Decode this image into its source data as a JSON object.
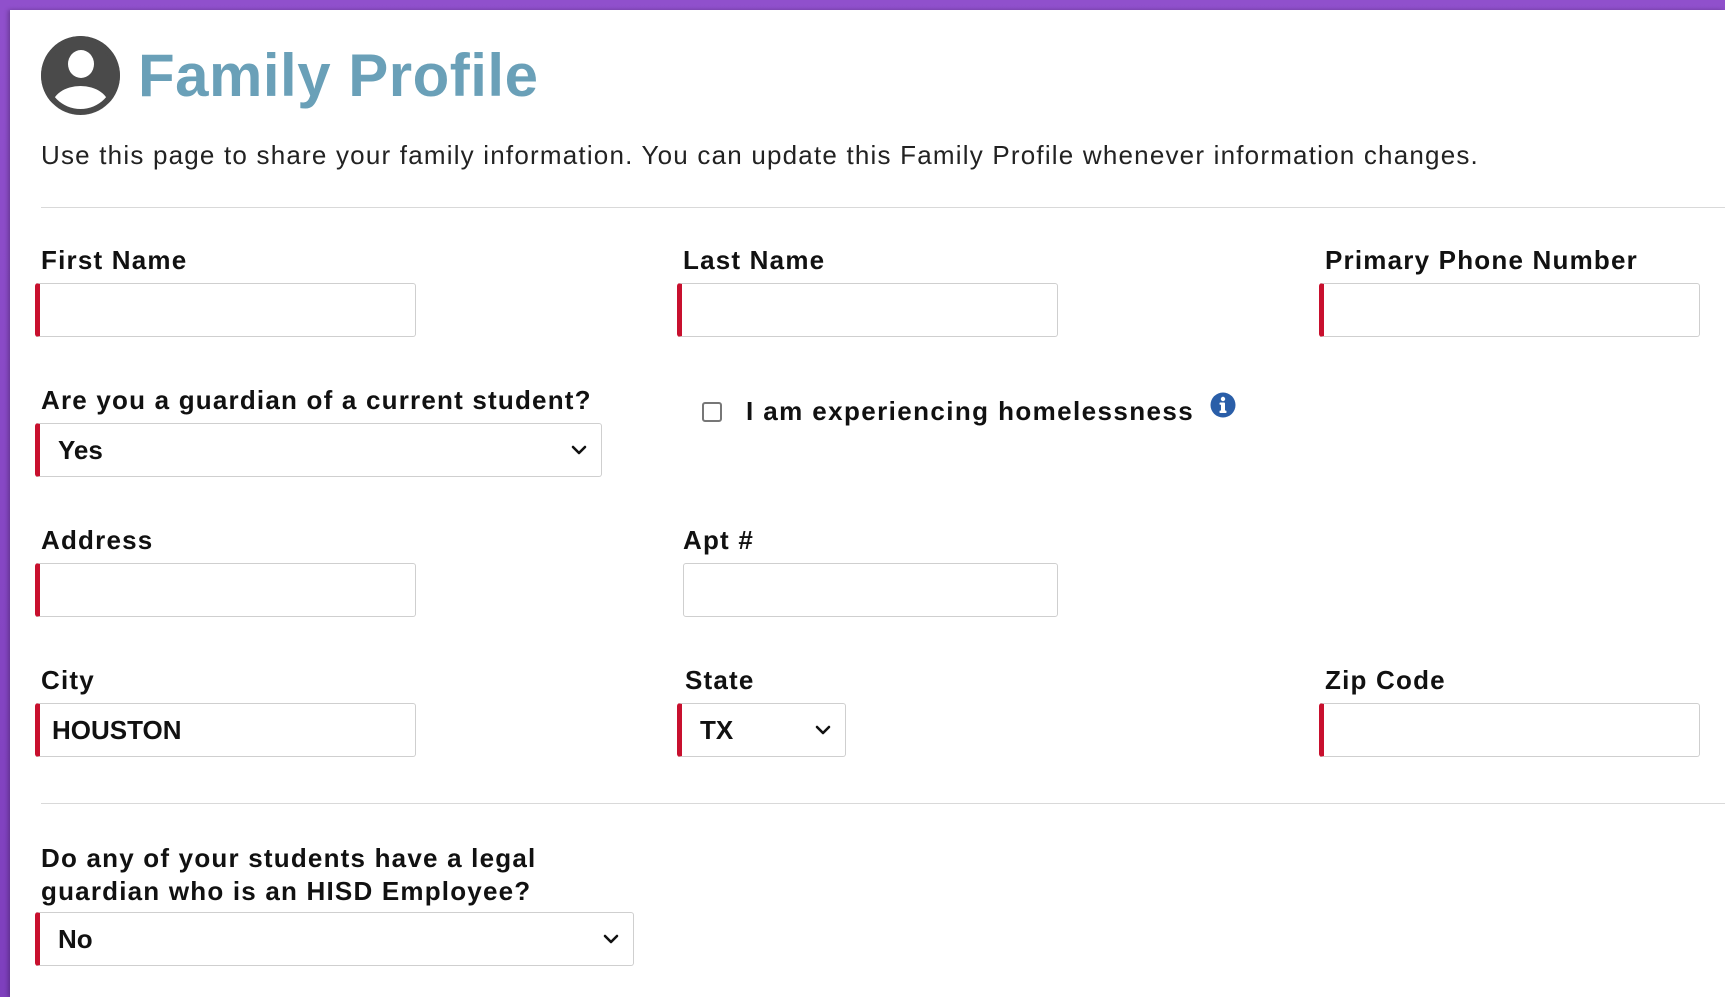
{
  "page": {
    "title": "Family Profile",
    "intro": "Use this page to share your family information. You can update this Family Profile whenever information changes."
  },
  "form": {
    "first_name": {
      "label": "First Name",
      "value": ""
    },
    "last_name": {
      "label": "Last Name",
      "value": ""
    },
    "phone": {
      "label": "Primary Phone Number",
      "value": ""
    },
    "guardian": {
      "label": "Are you a guardian of a current student?",
      "selected": "Yes"
    },
    "homeless": {
      "label": "I am experiencing homelessness",
      "checked": false
    },
    "address": {
      "label": "Address",
      "value": ""
    },
    "apt": {
      "label": "Apt #",
      "value": ""
    },
    "city": {
      "label": "City",
      "value": "HOUSTON"
    },
    "state": {
      "label": "State",
      "selected": "TX"
    },
    "zip": {
      "label": "Zip Code",
      "value": ""
    },
    "hisd_employee": {
      "label_line1": "Do any of your students have a legal",
      "label_line2": "guardian who is an HISD Employee?",
      "selected": "No"
    }
  },
  "colors": {
    "title": "#6aa0b8",
    "required_bar": "#c8102e",
    "info_icon": "#2a5ea8",
    "background": "#8a49c6"
  },
  "icons": {
    "avatar": "user-circle-icon",
    "info": "info-circle-icon",
    "select": "chevron-down-icon"
  }
}
